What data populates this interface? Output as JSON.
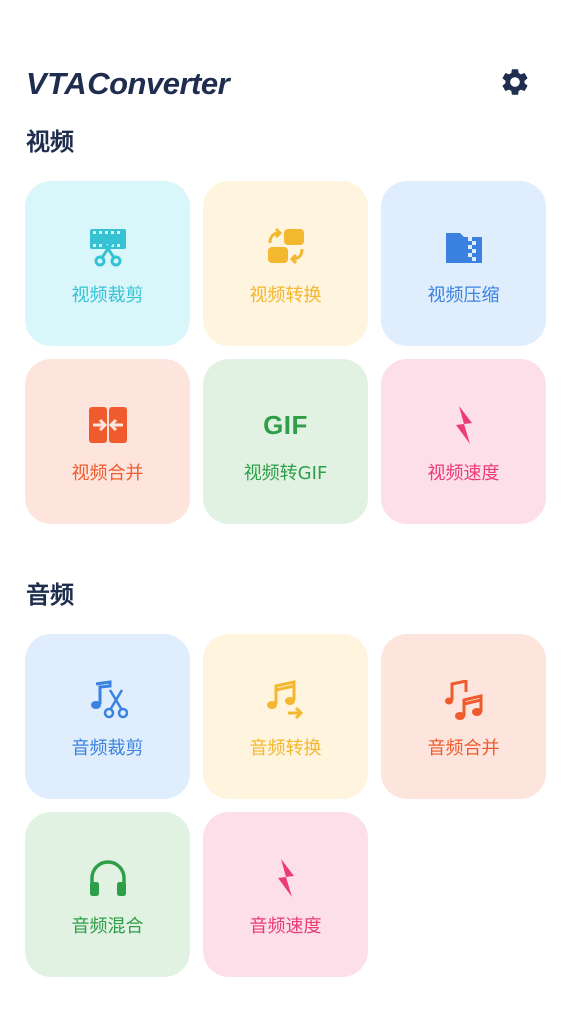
{
  "app": {
    "logo_bold": "VTA",
    "logo_rest": "Converter"
  },
  "sections": {
    "video": {
      "title": "视频",
      "tiles": [
        {
          "label": "视频裁剪",
          "icon": "film-scissors-icon"
        },
        {
          "label": "视频转换",
          "icon": "convert-arrows-icon"
        },
        {
          "label": "视频压缩",
          "icon": "zip-folder-icon"
        },
        {
          "label": "视频合并",
          "icon": "merge-arrows-icon"
        },
        {
          "label": "视频转GIF",
          "icon": "gif-icon",
          "icon_text": "GIF"
        },
        {
          "label": "视频速度",
          "icon": "lightning-bolt-icon"
        }
      ]
    },
    "audio": {
      "title": "音频",
      "tiles": [
        {
          "label": "音频裁剪",
          "icon": "music-scissors-icon"
        },
        {
          "label": "音频转换",
          "icon": "music-arrow-icon"
        },
        {
          "label": "音频合并",
          "icon": "double-music-note-icon"
        },
        {
          "label": "音频混合",
          "icon": "headphones-icon"
        },
        {
          "label": "音频速度",
          "icon": "lightning-bolt-icon"
        }
      ]
    }
  },
  "colors": {
    "cyan": "#37c2d4",
    "yellow": "#f4b730",
    "blue": "#3b82e0",
    "orange": "#ef5b2d",
    "green": "#2e9e48",
    "pink": "#ec3c74",
    "title": "#1f2d4e"
  }
}
